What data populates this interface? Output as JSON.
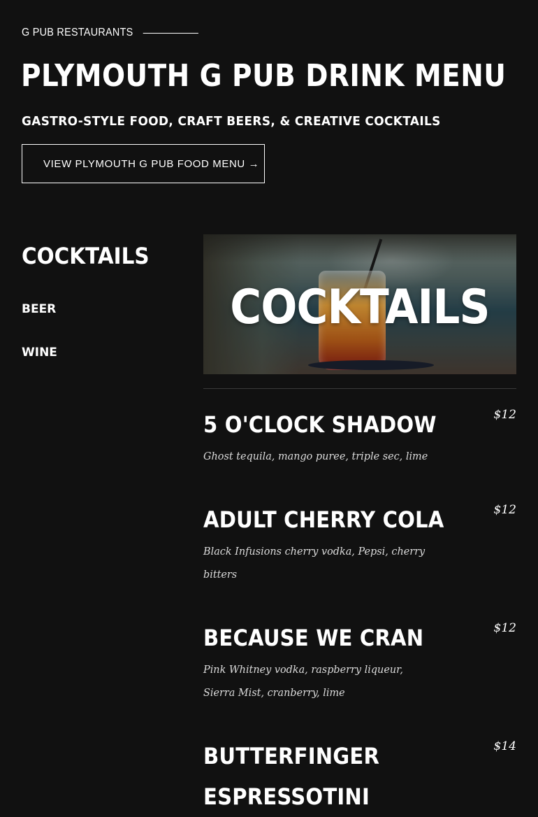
{
  "header": {
    "eyebrow": "G PUB RESTAURANTS",
    "title": "PLYMOUTH G PUB DRINK MENU",
    "subtitle": "GASTRO-STYLE FOOD, CRAFT BEERS, & CREATIVE COCKTAILS",
    "food_menu_button": "VIEW PLYMOUTH G PUB FOOD MENU →"
  },
  "sidebar": {
    "active": "COCKTAILS",
    "items": [
      {
        "label": "BEER"
      },
      {
        "label": "WINE"
      }
    ]
  },
  "hero": {
    "title": "COCKTAILS",
    "image": "cocktail-glass-photo"
  },
  "menu": {
    "items": [
      {
        "name": "5 O'CLOCK SHADOW",
        "price": "$12",
        "description": "Ghost tequila, mango puree, triple sec, lime"
      },
      {
        "name": "ADULT CHERRY COLA",
        "price": "$12",
        "description": "Black Infusions cherry vodka, Pepsi, cherry bitters"
      },
      {
        "name": "BECAUSE WE CRAN",
        "price": "$12",
        "description": "Pink Whitney vodka, raspberry liqueur, Sierra Mist, cranberry, lime"
      },
      {
        "name": "BUTTERFINGER ESPRESSOTINI",
        "price": "$14",
        "description": ""
      }
    ]
  },
  "colors": {
    "background": "#111111",
    "text": "#ffffff",
    "description_text": "#dcdcdc",
    "divider": "#3a3a3a"
  }
}
